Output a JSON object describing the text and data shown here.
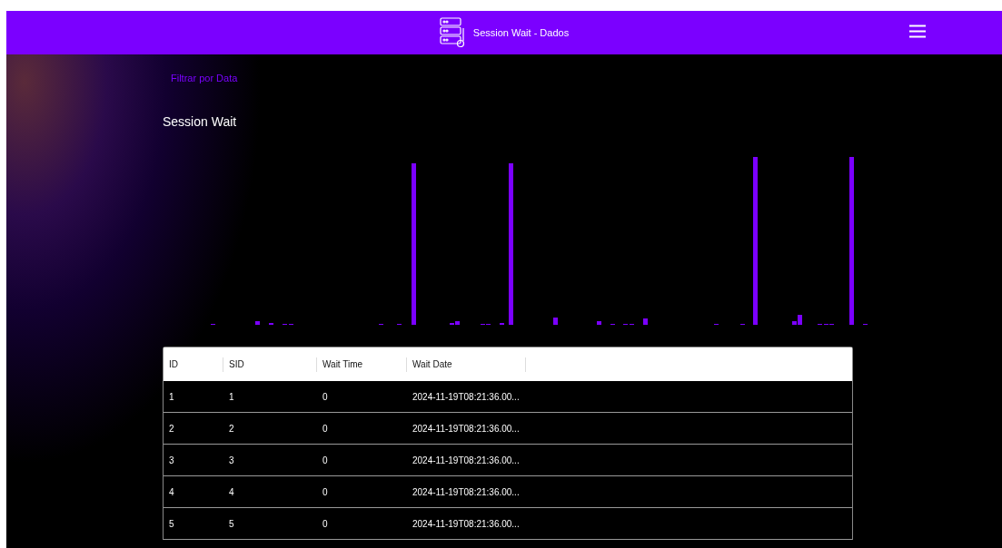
{
  "header": {
    "title": "Session Wait - Dados"
  },
  "filter_link": "Filtrar por Data",
  "section_title": "Session Wait",
  "table": {
    "columns": [
      "ID",
      "SID",
      "Wait Time",
      "Wait Date"
    ],
    "rows": [
      [
        "1",
        "1",
        "0",
        "2024-11-19T08:21:36.00..."
      ],
      [
        "2",
        "2",
        "0",
        "2024-11-19T08:21:36.00..."
      ],
      [
        "3",
        "3",
        "0",
        "2024-11-19T08:21:36.00..."
      ],
      [
        "4",
        "4",
        "0",
        "2024-11-19T08:21:36.00..."
      ],
      [
        "5",
        "5",
        "0",
        "2024-11-19T08:21:36.00..."
      ]
    ]
  }
}
